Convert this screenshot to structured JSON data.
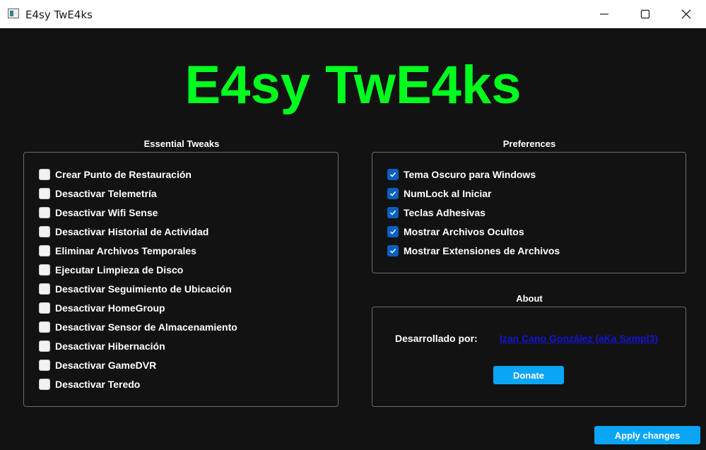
{
  "window": {
    "title": "E4sy TwE4ks",
    "icons": {
      "app": "app-window-icon",
      "minimize": "minimize-icon",
      "maximize": "maximize-icon",
      "close": "close-icon"
    }
  },
  "header": {
    "title": "E4sy TwE4ks",
    "color": "#00ff1e"
  },
  "essential": {
    "title": "Essential Tweaks",
    "items": [
      {
        "label": "Crear Punto de Restauración",
        "checked": false
      },
      {
        "label": "Desactivar Telemetría",
        "checked": false
      },
      {
        "label": "Desactivar Wifi Sense",
        "checked": false
      },
      {
        "label": "Desactivar Historial de Actividad",
        "checked": false
      },
      {
        "label": "Eliminar Archivos Temporales",
        "checked": false
      },
      {
        "label": "Ejecutar Limpieza de Disco",
        "checked": false
      },
      {
        "label": "Desactivar Seguimiento de Ubicación",
        "checked": false
      },
      {
        "label": "Desactivar HomeGroup",
        "checked": false
      },
      {
        "label": "Desactivar Sensor de Almacenamiento",
        "checked": false
      },
      {
        "label": "Desactivar Hibernación",
        "checked": false
      },
      {
        "label": "Desactivar GameDVR",
        "checked": false
      },
      {
        "label": "Desactivar Teredo",
        "checked": false
      }
    ]
  },
  "preferences": {
    "title": "Preferences",
    "items": [
      {
        "label": "Tema Oscuro para Windows",
        "checked": true
      },
      {
        "label": "NumLock al Iniciar",
        "checked": true
      },
      {
        "label": "Teclas Adhesivas",
        "checked": true
      },
      {
        "label": "Mostrar Archivos Ocultos",
        "checked": true
      },
      {
        "label": "Mostrar Extensiones de Archivos",
        "checked": true
      }
    ]
  },
  "about": {
    "title": "About",
    "developed_by_label": "Desarrollado por:",
    "author_link": "Izan Cano González (aKa Sxmpl3)",
    "donate_label": "Donate"
  },
  "footer": {
    "apply_label": "Apply changes"
  },
  "colors": {
    "background": "#121212",
    "accent": "#0aa5f5",
    "checkbox_checked": "#0a5fc0",
    "link": "#1414d6"
  }
}
